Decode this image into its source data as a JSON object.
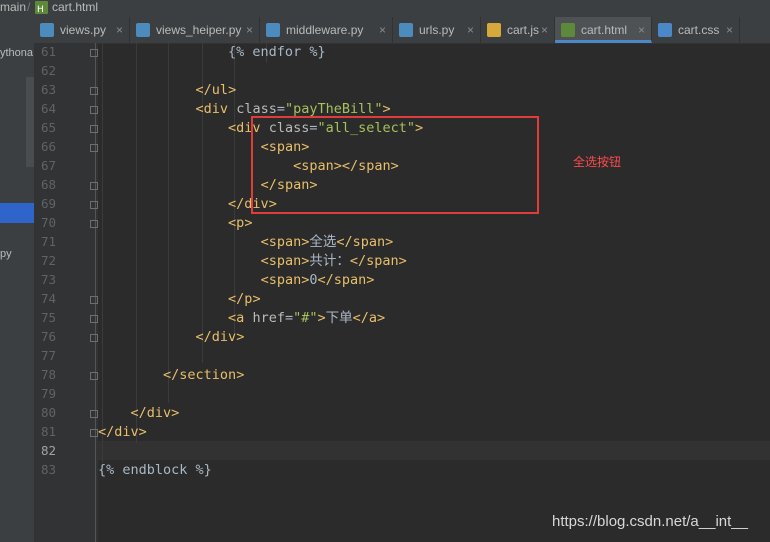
{
  "breadcrumb": {
    "project": "main",
    "file": "cart.html"
  },
  "left_panel": {
    "item1": "ythona",
    "item2": "py"
  },
  "tabs": [
    {
      "label": "views.py",
      "icon": "python-file-icon",
      "color": "#4b8bbe"
    },
    {
      "label": "views_heiper.py",
      "icon": "python-file-icon",
      "color": "#4b8bbe"
    },
    {
      "label": "middleware.py",
      "icon": "python-file-icon",
      "color": "#4b8bbe"
    },
    {
      "label": "urls.py",
      "icon": "python-file-icon",
      "color": "#4b8bbe"
    },
    {
      "label": "cart.js",
      "icon": "js-file-icon",
      "color": "#d7a93b"
    },
    {
      "label": "cart.html",
      "icon": "html-file-icon",
      "color": "#5c8a3a",
      "active": true
    },
    {
      "label": "cart.css",
      "icon": "css-file-icon",
      "color": "#4a88c7"
    }
  ],
  "line_numbers": [
    "61",
    "62",
    "63",
    "64",
    "65",
    "66",
    "67",
    "68",
    "69",
    "70",
    "71",
    "72",
    "73",
    "74",
    "75",
    "76",
    "77",
    "78",
    "79",
    "80",
    "81",
    "82",
    "83"
  ],
  "current_line": "82",
  "code_lines": [
    "                {% endfor %}",
    "",
    "            </ul>",
    "            <div class=\"payTheBill\">",
    "                <div class=\"all_select\">",
    "                    <span>",
    "                        <span></span>",
    "                    </span>",
    "                </div>",
    "                <p>",
    "                    <span>全选</span>",
    "                    <span>共计：</span>",
    "                    <span>0</span>",
    "                </p>",
    "                <a href=\"#\">下单</a>",
    "            </div>",
    "",
    "        </section>",
    "",
    "    </div>",
    "</div>",
    "",
    "{% endblock %}"
  ],
  "annotation": "全选按钮",
  "watermark": "https://blog.csdn.net/a__int__",
  "colors": {
    "highlight_box": "#e03c3c",
    "annotation": "#ff4a4a",
    "tag": "#e8bf6a",
    "attr_value": "#a5c25c",
    "active_tab_underline": "#4a88c7"
  }
}
